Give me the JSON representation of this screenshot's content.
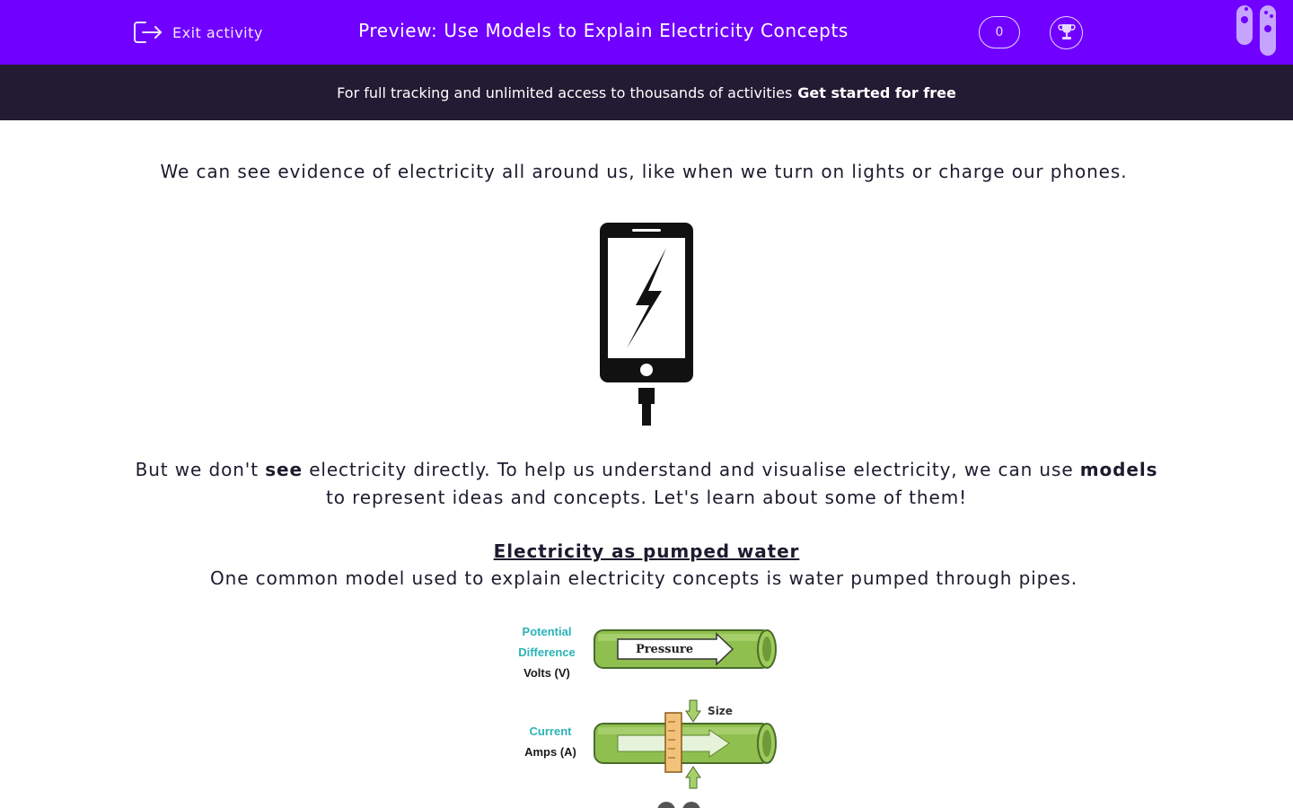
{
  "header": {
    "exit_label": "Exit activity",
    "title": "Preview: Use Models to Explain Electricity Concepts",
    "score": "0"
  },
  "promo": {
    "text": "For full tracking and unlimited access to thousands of activities",
    "cta": "Get started for free"
  },
  "content": {
    "intro": "We can see evidence of electricity all around us, like when we turn on lights or charge our phones.",
    "p2_part1": "But we don't ",
    "p2_bold1": "see",
    "p2_part2": " electricity directly. To help us understand and visualise electricity, we can use ",
    "p2_bold2": "models",
    "p2_part3": " to represent ideas and concepts. Let's learn about some of them!",
    "section_heading": "Electricity as pumped water",
    "section_text": "One common model used to explain electricity concepts is water pumped through pipes."
  },
  "diagram": {
    "pd_line1": "Potential",
    "pd_line2": "Difference",
    "pd_unit": "Volts (V)",
    "pressure": "Pressure",
    "current": "Current",
    "current_unit": "Amps (A)",
    "size": "Size"
  },
  "colors": {
    "brand_purple": "#7000ff",
    "promo_bg": "#231a33",
    "teal_label": "#2bb3b7",
    "pipe_green": "#8fbf4e"
  }
}
